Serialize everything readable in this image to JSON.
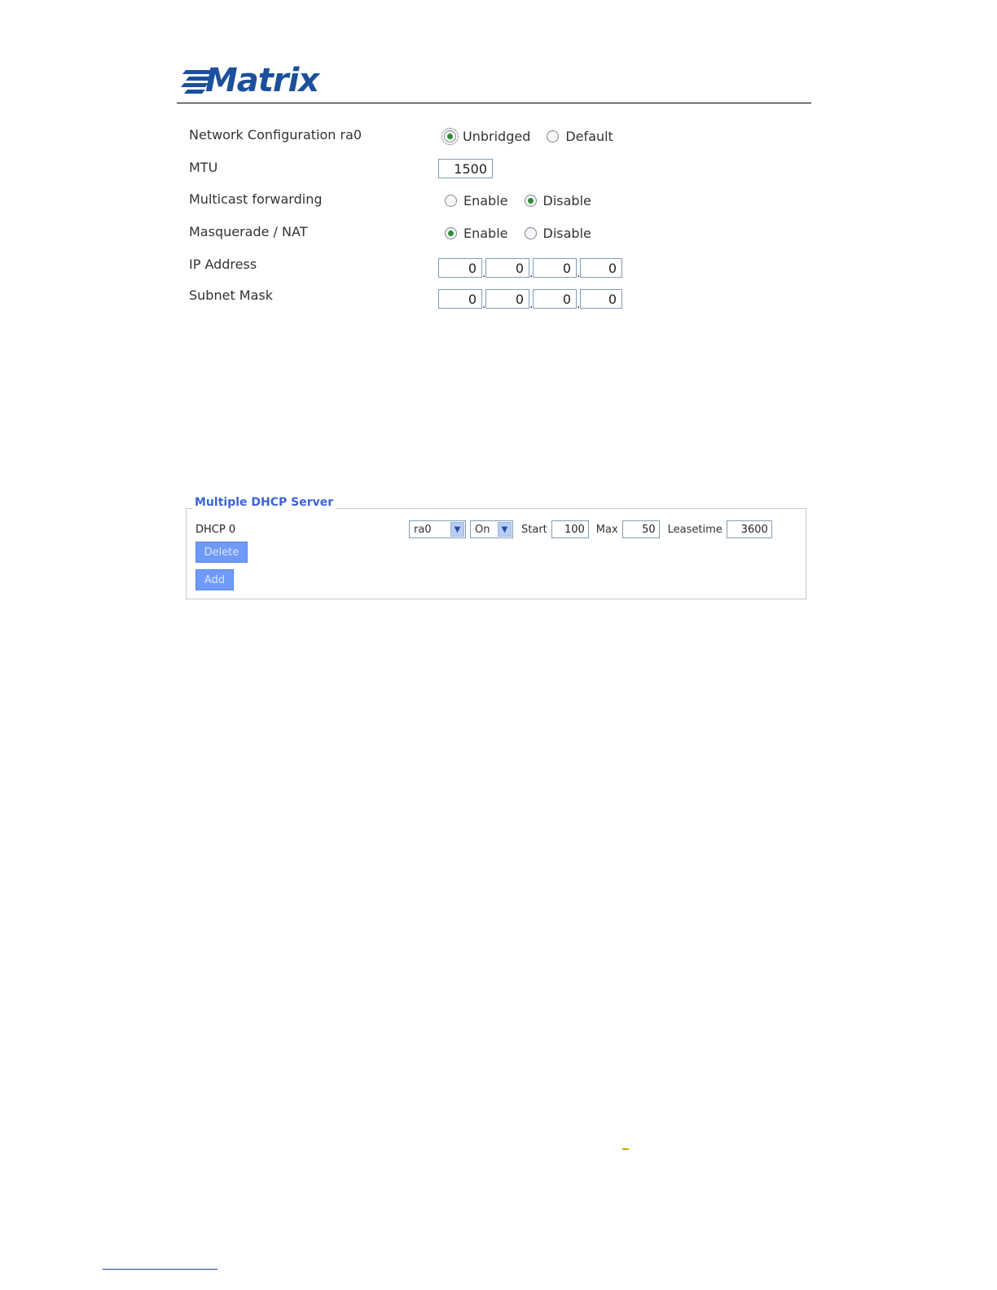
{
  "brand": {
    "logo_text": "Matrix"
  },
  "form": {
    "network_config": {
      "label": "Network Configuration ra0",
      "options": [
        "Unbridged",
        "Default"
      ],
      "selected": "Unbridged"
    },
    "mtu": {
      "label": "MTU",
      "value": "1500"
    },
    "multicast": {
      "label": "Multicast forwarding",
      "options": [
        "Enable",
        "Disable"
      ],
      "selected": "Disable"
    },
    "masquerade": {
      "label": "Masquerade / NAT",
      "options": [
        "Enable",
        "Disable"
      ],
      "selected": "Enable"
    },
    "ip_address": {
      "label": "IP Address",
      "octets": [
        "0",
        "0",
        "0",
        "0"
      ]
    },
    "subnet_mask": {
      "label": "Subnet Mask",
      "octets": [
        "0",
        "0",
        "0",
        "0"
      ]
    }
  },
  "dhcp": {
    "legend": "Multiple DHCP Server",
    "entry": {
      "label": "DHCP 0",
      "interface": "ra0",
      "state": "On",
      "start_label": "Start",
      "start": "100",
      "max_label": "Max",
      "max": "50",
      "lease_label": "Leasetime",
      "lease": "3600"
    },
    "delete_label": "Delete",
    "add_label": "Add"
  },
  "colors": {
    "brand": "#1c4f9c",
    "legend": "#3c64d6",
    "button": "#6f9af7",
    "radio_checked": "#2f8a3c"
  }
}
